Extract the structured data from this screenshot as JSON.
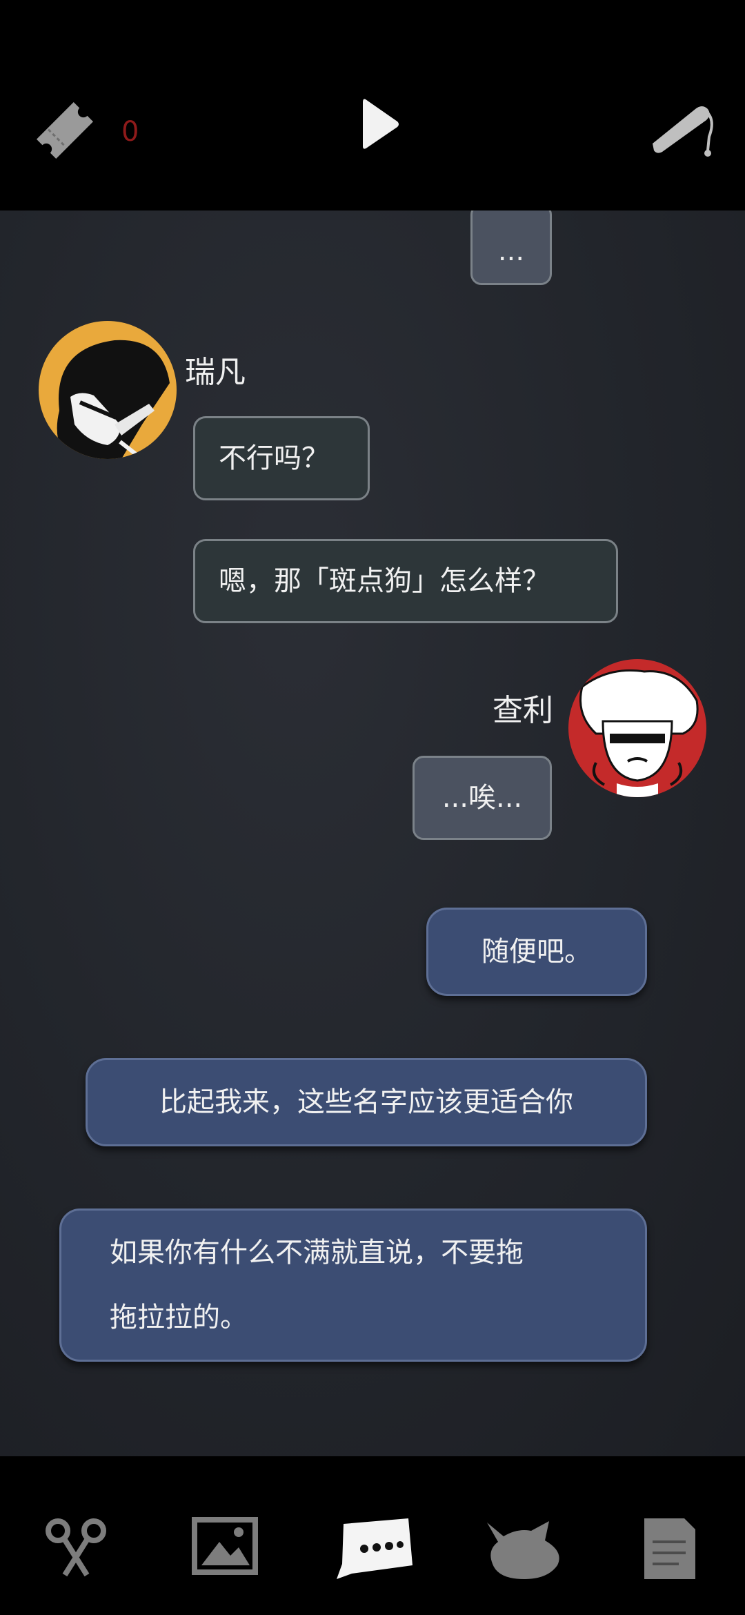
{
  "top_bar": {
    "ticket_count": "0",
    "icons": [
      "ticket-icon",
      "play-icon",
      "whistle-icon"
    ]
  },
  "chat": {
    "messages": [
      {
        "sender": "",
        "text": "...",
        "style": "gray"
      },
      {
        "sender": "瑞凡",
        "text": "不行吗？",
        "style": "dark"
      },
      {
        "sender": "瑞凡",
        "text": "嗯，那「斑点狗」怎么样？",
        "style": "dark"
      },
      {
        "sender": "查利",
        "text": "...唉...",
        "style": "gray"
      },
      {
        "sender": "",
        "text": "随便吧。",
        "style": "blue-option"
      },
      {
        "sender": "",
        "text": "比起我来，这些名字应该更适合你",
        "style": "blue-option"
      },
      {
        "sender": "",
        "text_line1": "如果你有什么不满就直说，不要拖",
        "text_line2": "拖拉拉的。",
        "style": "blue-option"
      }
    ],
    "names": {
      "left": "瑞凡",
      "right": "查利"
    }
  },
  "bottom_nav": {
    "items": [
      "scissors-icon",
      "gallery-icon",
      "chat-icon",
      "beast-icon",
      "notes-icon"
    ],
    "active": "chat-icon"
  },
  "colors": {
    "accent_red": "#8e1a1a",
    "option_blue": "#3c4d73",
    "bubble_dark": "#2d3639",
    "avatar_orange": "#e9a93c",
    "avatar_red": "#c42a2a"
  }
}
